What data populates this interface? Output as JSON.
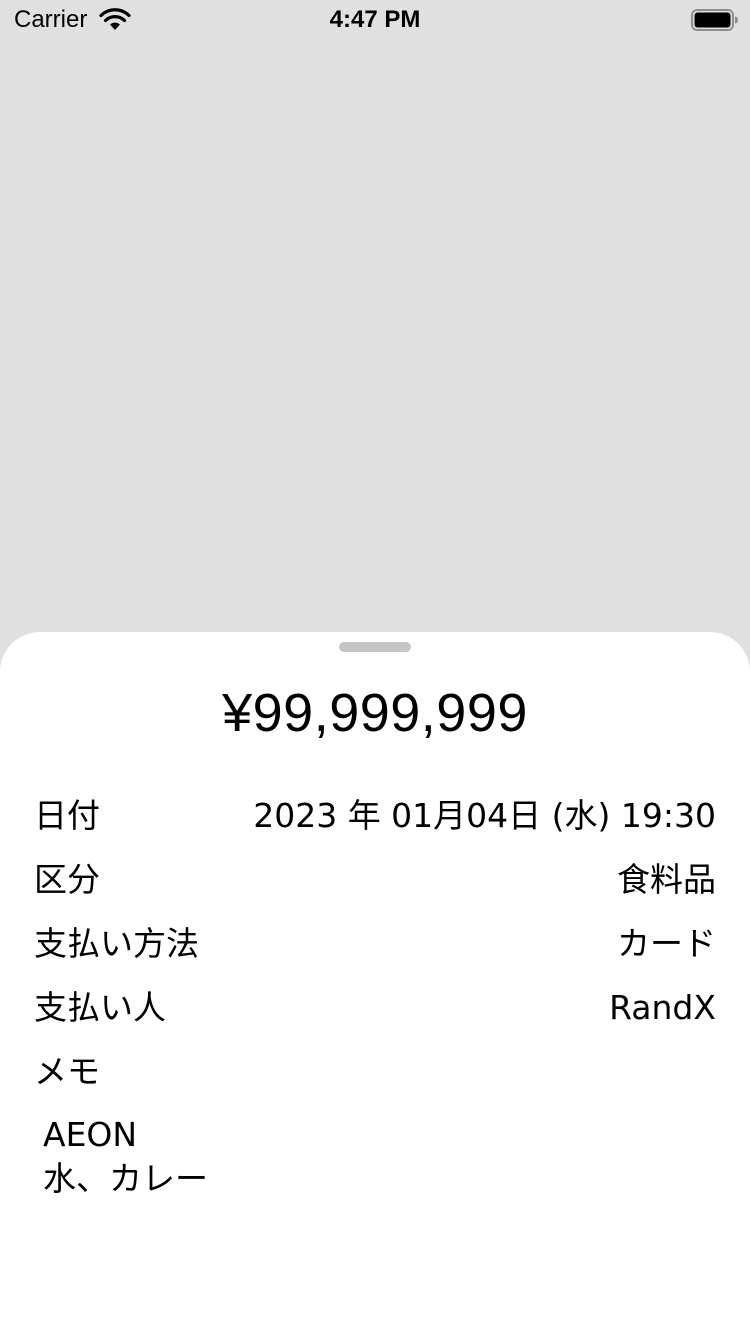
{
  "status_bar": {
    "carrier": "Carrier",
    "time": "4:47 PM",
    "wifi_icon": "wifi-icon",
    "battery_icon": "battery-icon"
  },
  "detail": {
    "amount": "¥99,999,999",
    "date_label": "日付",
    "date_value": "2023 年 01月04日 (水) 19:30",
    "category_label": "区分",
    "category_value": "食料品",
    "payment_method_label": "支払い方法",
    "payment_method_value": "カード",
    "payer_label": "支払い人",
    "payer_value": "RandX",
    "memo_label": "メモ",
    "memo_lines": [
      "AEON",
      "水、カレー"
    ]
  },
  "colors": {
    "backdrop": "#e0e0e0",
    "sheet": "#ffffff",
    "grabber": "#c6c6c8",
    "text": "#000000"
  }
}
